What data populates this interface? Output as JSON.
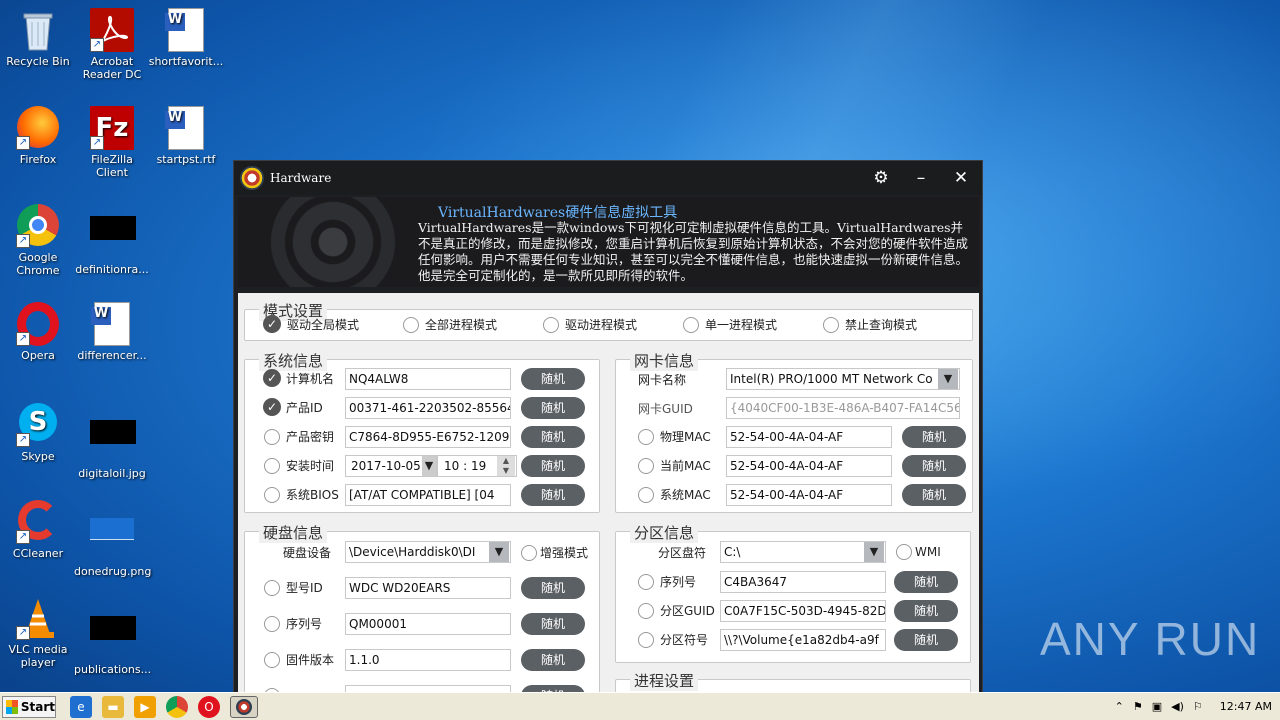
{
  "desktop": {
    "icons": [
      {
        "name": "recycle-bin",
        "label": "Recycle Bin"
      },
      {
        "name": "acrobat",
        "label": "Acrobat Reader DC"
      },
      {
        "name": "shortfavorit",
        "label": "shortfavorit..."
      },
      {
        "name": "firefox",
        "label": "Firefox"
      },
      {
        "name": "filezilla",
        "label": "FileZilla Client"
      },
      {
        "name": "startpst",
        "label": "startpst.rtf"
      },
      {
        "name": "chrome",
        "label": "Google Chrome"
      },
      {
        "name": "definitionra",
        "label": "definitionra..."
      },
      {
        "name": "opera",
        "label": "Opera"
      },
      {
        "name": "differencer",
        "label": "differencer..."
      },
      {
        "name": "skype",
        "label": "Skype"
      },
      {
        "name": "digitaloil",
        "label": "digitaloil.jpg"
      },
      {
        "name": "ccleaner",
        "label": "CCleaner"
      },
      {
        "name": "donedrug",
        "label": "donedrug.png"
      },
      {
        "name": "vlc",
        "label": "VLC media player"
      },
      {
        "name": "publications",
        "label": "publications..."
      }
    ],
    "watermark": "ANY RUN"
  },
  "window": {
    "title": "Hardware",
    "banner_title": "VirtualHardwares硬件信息虚拟工具",
    "banner_desc": "VirtualHardwares是一款windows下可视化可定制虚拟硬件信息的工具。VirtualHardwares并不是真正的修改，而是虚拟修改，您重启计算机后恢复到原始计算机状态，不会对您的硬件软件造成任何影响。用户不需要任何专业知识，甚至可以完全不懂硬件信息，也能快速虚拟一份新硬件信息。他是完全可定制化的，是一款所见即所得的软件。"
  },
  "mode": {
    "legend": "模式设置",
    "options": [
      "驱动全局模式",
      "全部进程模式",
      "驱动进程模式",
      "单一进程模式",
      "禁止查询模式"
    ]
  },
  "system": {
    "legend": "系统信息",
    "rows": [
      {
        "label": "计算机名",
        "value": "NQ4ALW8"
      },
      {
        "label": "产品ID",
        "value": "00371-461-2203502-85564"
      },
      {
        "label": "产品密钥",
        "value": "C7864-8D955-E6752-12091"
      },
      {
        "label": "安装时间",
        "value": "2017-10-05",
        "time": "10 : 19"
      },
      {
        "label": "系统BIOS",
        "value": "[AT/AT COMPATIBLE] [04"
      }
    ]
  },
  "nic": {
    "legend": "网卡信息",
    "name_label": "网卡名称",
    "name_value": "Intel(R) PRO/1000 MT Network Co",
    "guid_label": "网卡GUID",
    "guid_value": "{4040CF00-1B3E-486A-B407-FA14C56E",
    "rows": [
      {
        "label": "物理MAC",
        "value": "52-54-00-4A-04-AF"
      },
      {
        "label": "当前MAC",
        "value": "52-54-00-4A-04-AF"
      },
      {
        "label": "系统MAC",
        "value": "52-54-00-4A-04-AF"
      }
    ]
  },
  "disk": {
    "legend": "硬盘信息",
    "device_label": "硬盘设备",
    "device_value": "\\Device\\Harddisk0\\DI",
    "enhanced": "增强模式",
    "rows": [
      {
        "label": "型号ID",
        "value": "WDC WD20EARS"
      },
      {
        "label": "序列号",
        "value": "QM00001"
      },
      {
        "label": "固件版本",
        "value": "1.1.0"
      }
    ]
  },
  "partition": {
    "legend": "分区信息",
    "drive_label": "分区盘符",
    "drive_value": "C:\\",
    "wmi": "WMI",
    "rows": [
      {
        "label": "序列号",
        "value": "C4BA3647"
      },
      {
        "label": "分区GUID",
        "value": "C0A7F15C-503D-4945-82D"
      },
      {
        "label": "分区符号",
        "value": "\\\\?\\Volume{e1a82db4-a9f"
      }
    ]
  },
  "process": {
    "legend": "进程设置"
  },
  "random_label": "随机",
  "taskbar": {
    "start": "Start",
    "clock": "12:47 AM"
  }
}
